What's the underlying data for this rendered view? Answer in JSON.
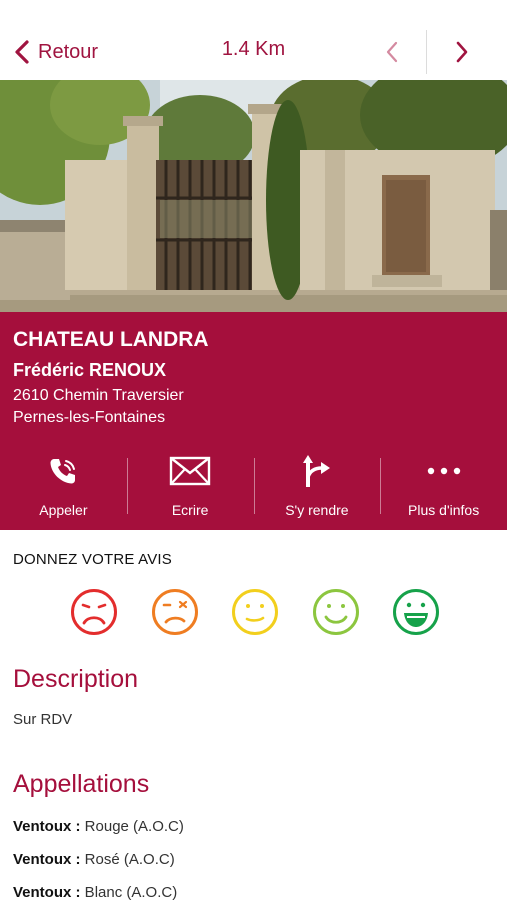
{
  "header": {
    "back_label": "Retour",
    "distance": "1.4 Km"
  },
  "photo": {
    "subject": "chateau-gate-photo"
  },
  "domain": {
    "name": "CHATEAU LANDRA",
    "owner": "Frédéric RENOUX",
    "address_line1": "2610 Chemin Traversier",
    "address_line2": "Pernes-les-Fontaines"
  },
  "actions": [
    {
      "label": "Appeler",
      "icon": "phone-icon"
    },
    {
      "label": "Ecrire",
      "icon": "envelope-icon"
    },
    {
      "label": "S'y rendre",
      "icon": "directions-icon"
    },
    {
      "label": "Plus d'infos",
      "icon": "more-icon"
    }
  ],
  "rating": {
    "title": "DONNEZ VOTRE AVIS",
    "options": [
      {
        "icon": "very-sad-face-icon",
        "color": "#e32d2d"
      },
      {
        "icon": "sad-face-icon",
        "color": "#ef7d22"
      },
      {
        "icon": "neutral-face-icon",
        "color": "#f2cf1d"
      },
      {
        "icon": "happy-face-icon",
        "color": "#8cc63f"
      },
      {
        "icon": "very-happy-face-icon",
        "color": "#16a24a"
      }
    ]
  },
  "description": {
    "title": "Description",
    "text": "Sur RDV"
  },
  "appellations": {
    "title": "Appellations",
    "items": [
      {
        "name": "Ventoux :",
        "value": " Rouge (A.O.C)"
      },
      {
        "name": "Ventoux :",
        "value": " Rosé (A.O.C)"
      },
      {
        "name": "Ventoux :",
        "value": " Blanc (A.O.C)"
      }
    ]
  },
  "colors": {
    "brand": "#a50f3c",
    "background": "#ffffff"
  }
}
